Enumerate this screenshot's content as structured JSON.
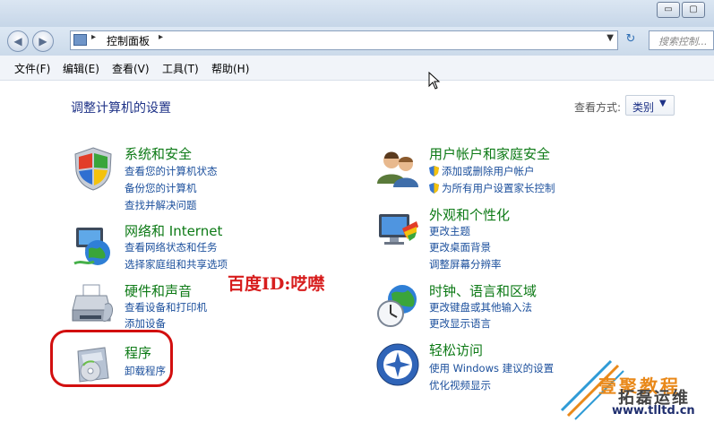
{
  "window": {
    "minimize": "▭",
    "maximize": "▢"
  },
  "navbar": {
    "back": "◀",
    "forward": "▶",
    "address_separator": "▸",
    "address": "控制面板",
    "address_separator2": "▸",
    "dropdown": "▼",
    "refresh": "↻",
    "search_placeholder": "搜索控制..."
  },
  "menu": [
    "文件(F)",
    "编辑(E)",
    "查看(V)",
    "工具(T)",
    "帮助(H)"
  ],
  "page": {
    "heading": "调整计算机的设置",
    "view_by_label": "查看方式:",
    "view_by_value": "类别",
    "view_by_arrow": "▼"
  },
  "categories": [
    {
      "title": "系统和安全",
      "icon": "shield-windows-icon",
      "links": [
        "查看您的计算机状态",
        "备份您的计算机",
        "查找并解决问题"
      ]
    },
    {
      "title": "网络和 Internet",
      "icon": "network-globe-icon",
      "links": [
        "查看网络状态和任务",
        "选择家庭组和共享选项"
      ]
    },
    {
      "title": "硬件和声音",
      "icon": "printer-icon",
      "links": [
        "查看设备和打印机",
        "添加设备"
      ]
    },
    {
      "title": "程序",
      "icon": "programs-disc-icon",
      "links": [
        "卸载程序"
      ]
    },
    {
      "title": "用户帐户和家庭安全",
      "icon": "users-icon",
      "links": [
        "添加或删除用户帐户",
        "为所有用户设置家长控制"
      ]
    },
    {
      "title": "外观和个性化",
      "icon": "monitor-paint-icon",
      "links": [
        "更改主题",
        "更改桌面背景",
        "调整屏幕分辨率"
      ]
    },
    {
      "title": "时钟、语言和区域",
      "icon": "clock-globe-icon",
      "links": [
        "更改键盘或其他输入法",
        "更改显示语言"
      ]
    },
    {
      "title": "轻松访问",
      "icon": "ease-of-access-icon",
      "links": [
        "使用 Windows 建议的设置",
        "优化视频显示"
      ]
    }
  ],
  "overlay": {
    "watermark": "百度ID:呓噤",
    "logo_line1": "壹聚教程",
    "logo_line2": "拓磊运维",
    "logo_url": "www.tlltd.cn"
  },
  "colors": {
    "category_title": "#0d7a16",
    "link": "#1b4f9c",
    "heading": "#1e3287",
    "highlight": "#d20f0f"
  }
}
